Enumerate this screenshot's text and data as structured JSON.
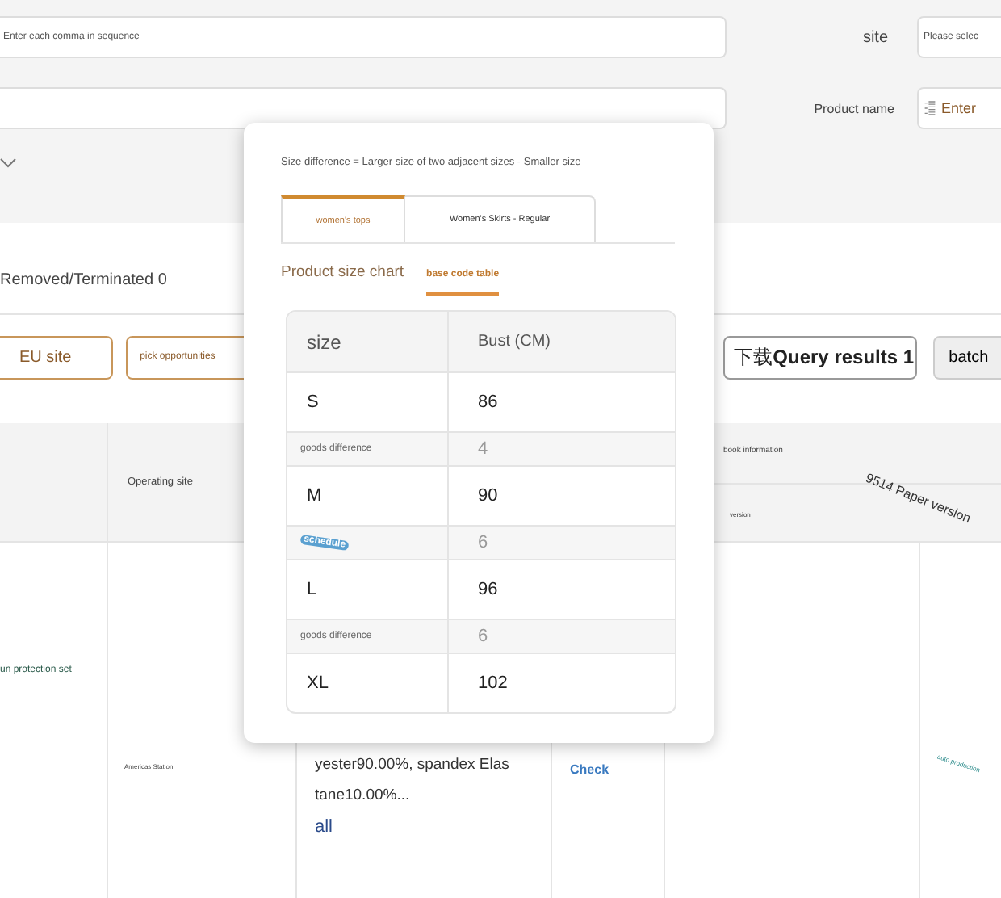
{
  "filters": [
    {
      "kind": "select",
      "main_placeholder": "Enter each comma in sequence",
      "label": "site",
      "side_placeholder": "Please selec"
    },
    {
      "kind": "text",
      "label": "Product name",
      "side_placeholder": "Enter"
    }
  ],
  "status": "Removed/Terminated 0",
  "actions": [
    {
      "kind": "outline",
      "label": "EU site"
    },
    {
      "kind": "outline-small",
      "label": "pick opportunities"
    },
    {
      "kind": "plain",
      "label": "下载**Query results 1**"
    },
    {
      "kind": "grey",
      "label": "batch"
    }
  ],
  "table": {
    "header": {
      "operating_site": "Operating site",
      "book_information": "book information",
      "version": "version",
      "paper_version": "9514 Paper version"
    },
    "row": {
      "column_1": "un protection set",
      "operating_site": "Americas Station",
      "description_lines": [
        "yester90.00%, spandex Elas",
        "tane10.00%..."
      ],
      "more_link": "all",
      "check_link": "Check",
      "column_6": "auto production"
    }
  },
  "popup": {
    "note": "Size difference = Larger size of two adjacent sizes - Smaller size",
    "tabs": [
      {
        "label": "women's tops",
        "selected": true
      },
      {
        "label": "Women's Skirts - Regular",
        "selected": false
      }
    ],
    "subtabs": [
      {
        "label": "Product size chart",
        "selected": false
      },
      {
        "label": "base code table",
        "selected": true
      }
    ],
    "columns": [
      "size",
      "Bust (CM)"
    ],
    "rows": [
      {
        "kind": "size",
        "label": "S",
        "value": "86"
      },
      {
        "kind": "difference",
        "label": "goods difference",
        "value": "4"
      },
      {
        "kind": "size",
        "label": "M",
        "value": "90"
      },
      {
        "kind": "difference-badge",
        "label": "schedule",
        "value": "6"
      },
      {
        "kind": "size",
        "label": "L",
        "value": "96"
      },
      {
        "kind": "difference",
        "label": "goods difference",
        "value": "6"
      },
      {
        "kind": "size",
        "label": "XL",
        "value": "102"
      }
    ]
  }
}
